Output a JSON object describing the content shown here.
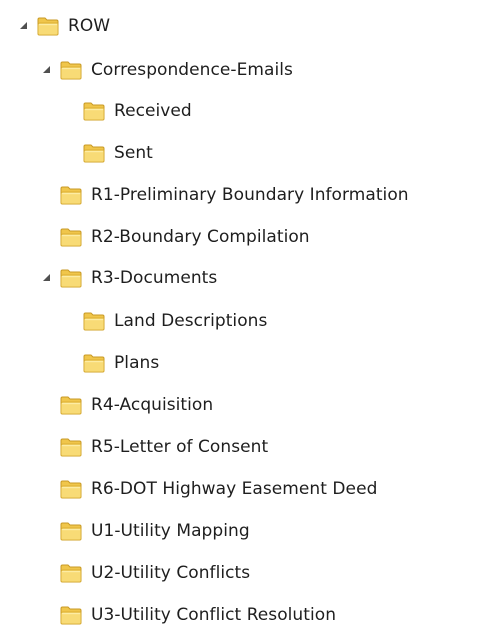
{
  "icons": {
    "expanded": "expanded-triangle-icon",
    "folder": "folder-icon"
  },
  "colors": {
    "folder_body": "#f0c64b",
    "folder_front": "#f8db76",
    "folder_edge": "#c99a25",
    "expander": "#505050"
  },
  "tree": {
    "root": {
      "label": "ROW",
      "expanded": true
    },
    "correspondence": {
      "label": "Correspondence-Emails",
      "expanded": true
    },
    "received": {
      "label": "Received"
    },
    "sent": {
      "label": "Sent"
    },
    "r1": {
      "label": "R1-Preliminary Boundary Information"
    },
    "r2": {
      "label": "R2-Boundary Compilation"
    },
    "r3": {
      "label": "R3-Documents",
      "expanded": true
    },
    "land": {
      "label": "Land Descriptions"
    },
    "plans": {
      "label": "Plans"
    },
    "r4": {
      "label": "R4-Acquisition"
    },
    "r5": {
      "label": "R5-Letter of Consent"
    },
    "r6": {
      "label": "R6-DOT Highway Easement Deed"
    },
    "u1": {
      "label": "U1-Utility Mapping"
    },
    "u2": {
      "label": "U2-Utility Conflicts"
    },
    "u3": {
      "label": "U3-Utility Conflict Resolution"
    }
  }
}
